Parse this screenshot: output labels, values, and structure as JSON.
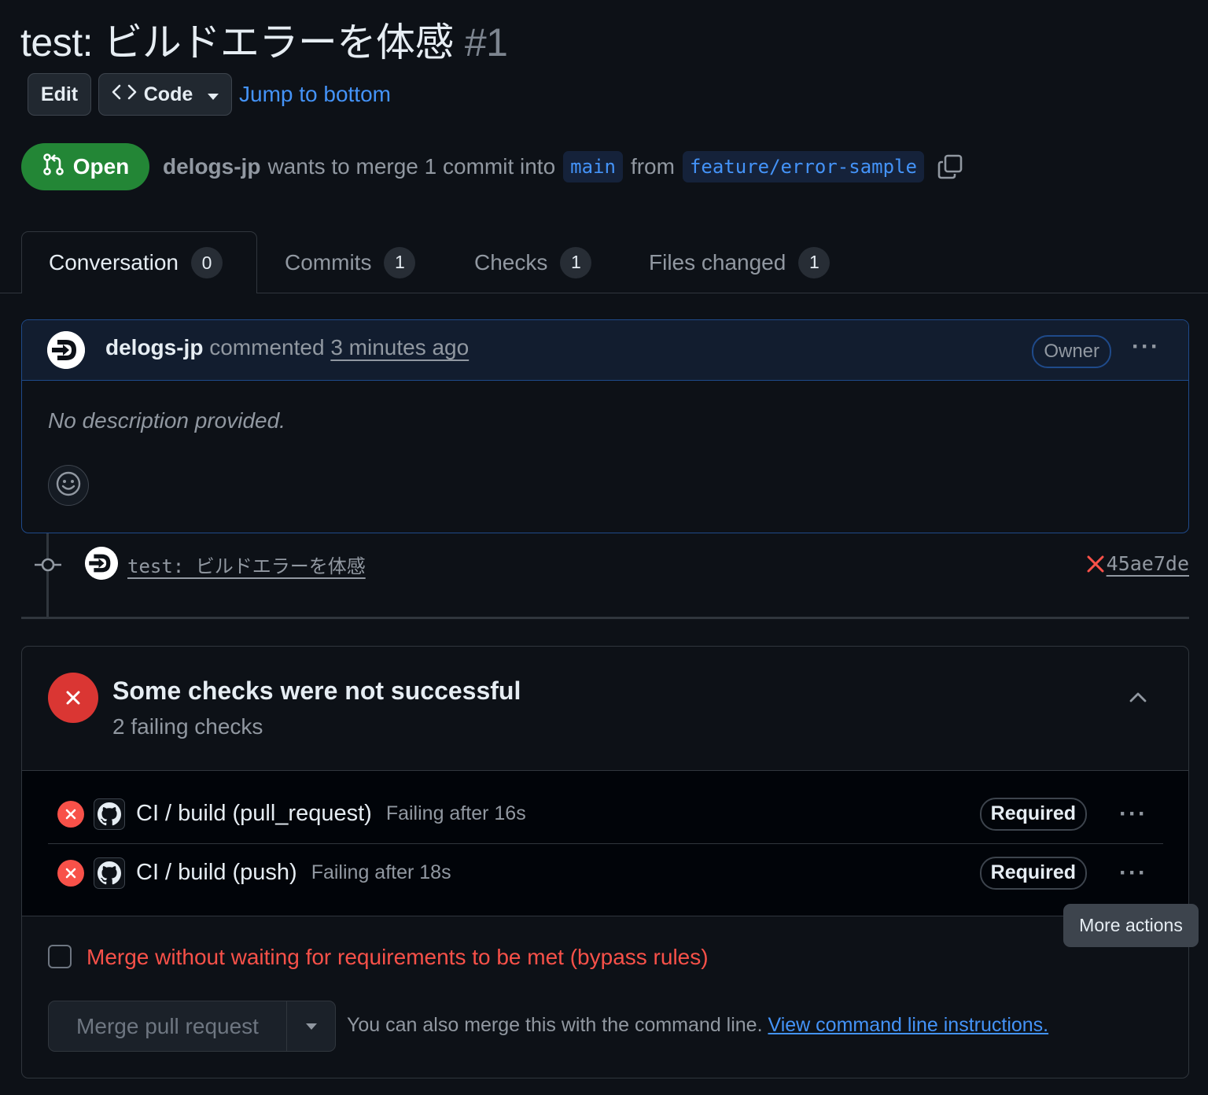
{
  "pr": {
    "title": "test: ビルドエラーを体感",
    "number": "#1",
    "state": "Open",
    "author": "delogs-jp",
    "merge_text": "wants to merge 1 commit into",
    "base_branch": "main",
    "from_text": "from",
    "head_branch": "feature/error-sample"
  },
  "toolbar": {
    "edit_label": "Edit",
    "code_label": "Code",
    "jump_label": "Jump to bottom"
  },
  "tabs": [
    {
      "label": "Conversation",
      "count": "0"
    },
    {
      "label": "Commits",
      "count": "1"
    },
    {
      "label": "Checks",
      "count": "1"
    },
    {
      "label": "Files changed",
      "count": "1"
    }
  ],
  "comment": {
    "author": "delogs-jp",
    "action": "commented",
    "time": "3 minutes ago",
    "role": "Owner",
    "body": "No description provided."
  },
  "commit": {
    "message": "test: ビルドエラーを体感",
    "sha": "45ae7de"
  },
  "checks": {
    "title": "Some checks were not successful",
    "subtitle": "2 failing checks",
    "items": [
      {
        "name": "CI / build (pull_request)",
        "status": "Failing after 16s",
        "badge": "Required"
      },
      {
        "name": "CI / build (push)",
        "status": "Failing after 18s",
        "badge": "Required"
      }
    ],
    "tooltip": "More actions"
  },
  "merge": {
    "bypass_label": "Merge without waiting for requirements to be met (bypass rules)",
    "button_label": "Merge pull request",
    "cmd_text": "You can also merge this with the command line.",
    "cmd_link": "View command line instructions."
  },
  "colors": {
    "background": "#0d1117",
    "open_green": "#238636",
    "link_blue": "#4493f8",
    "danger_red": "#f85149"
  }
}
